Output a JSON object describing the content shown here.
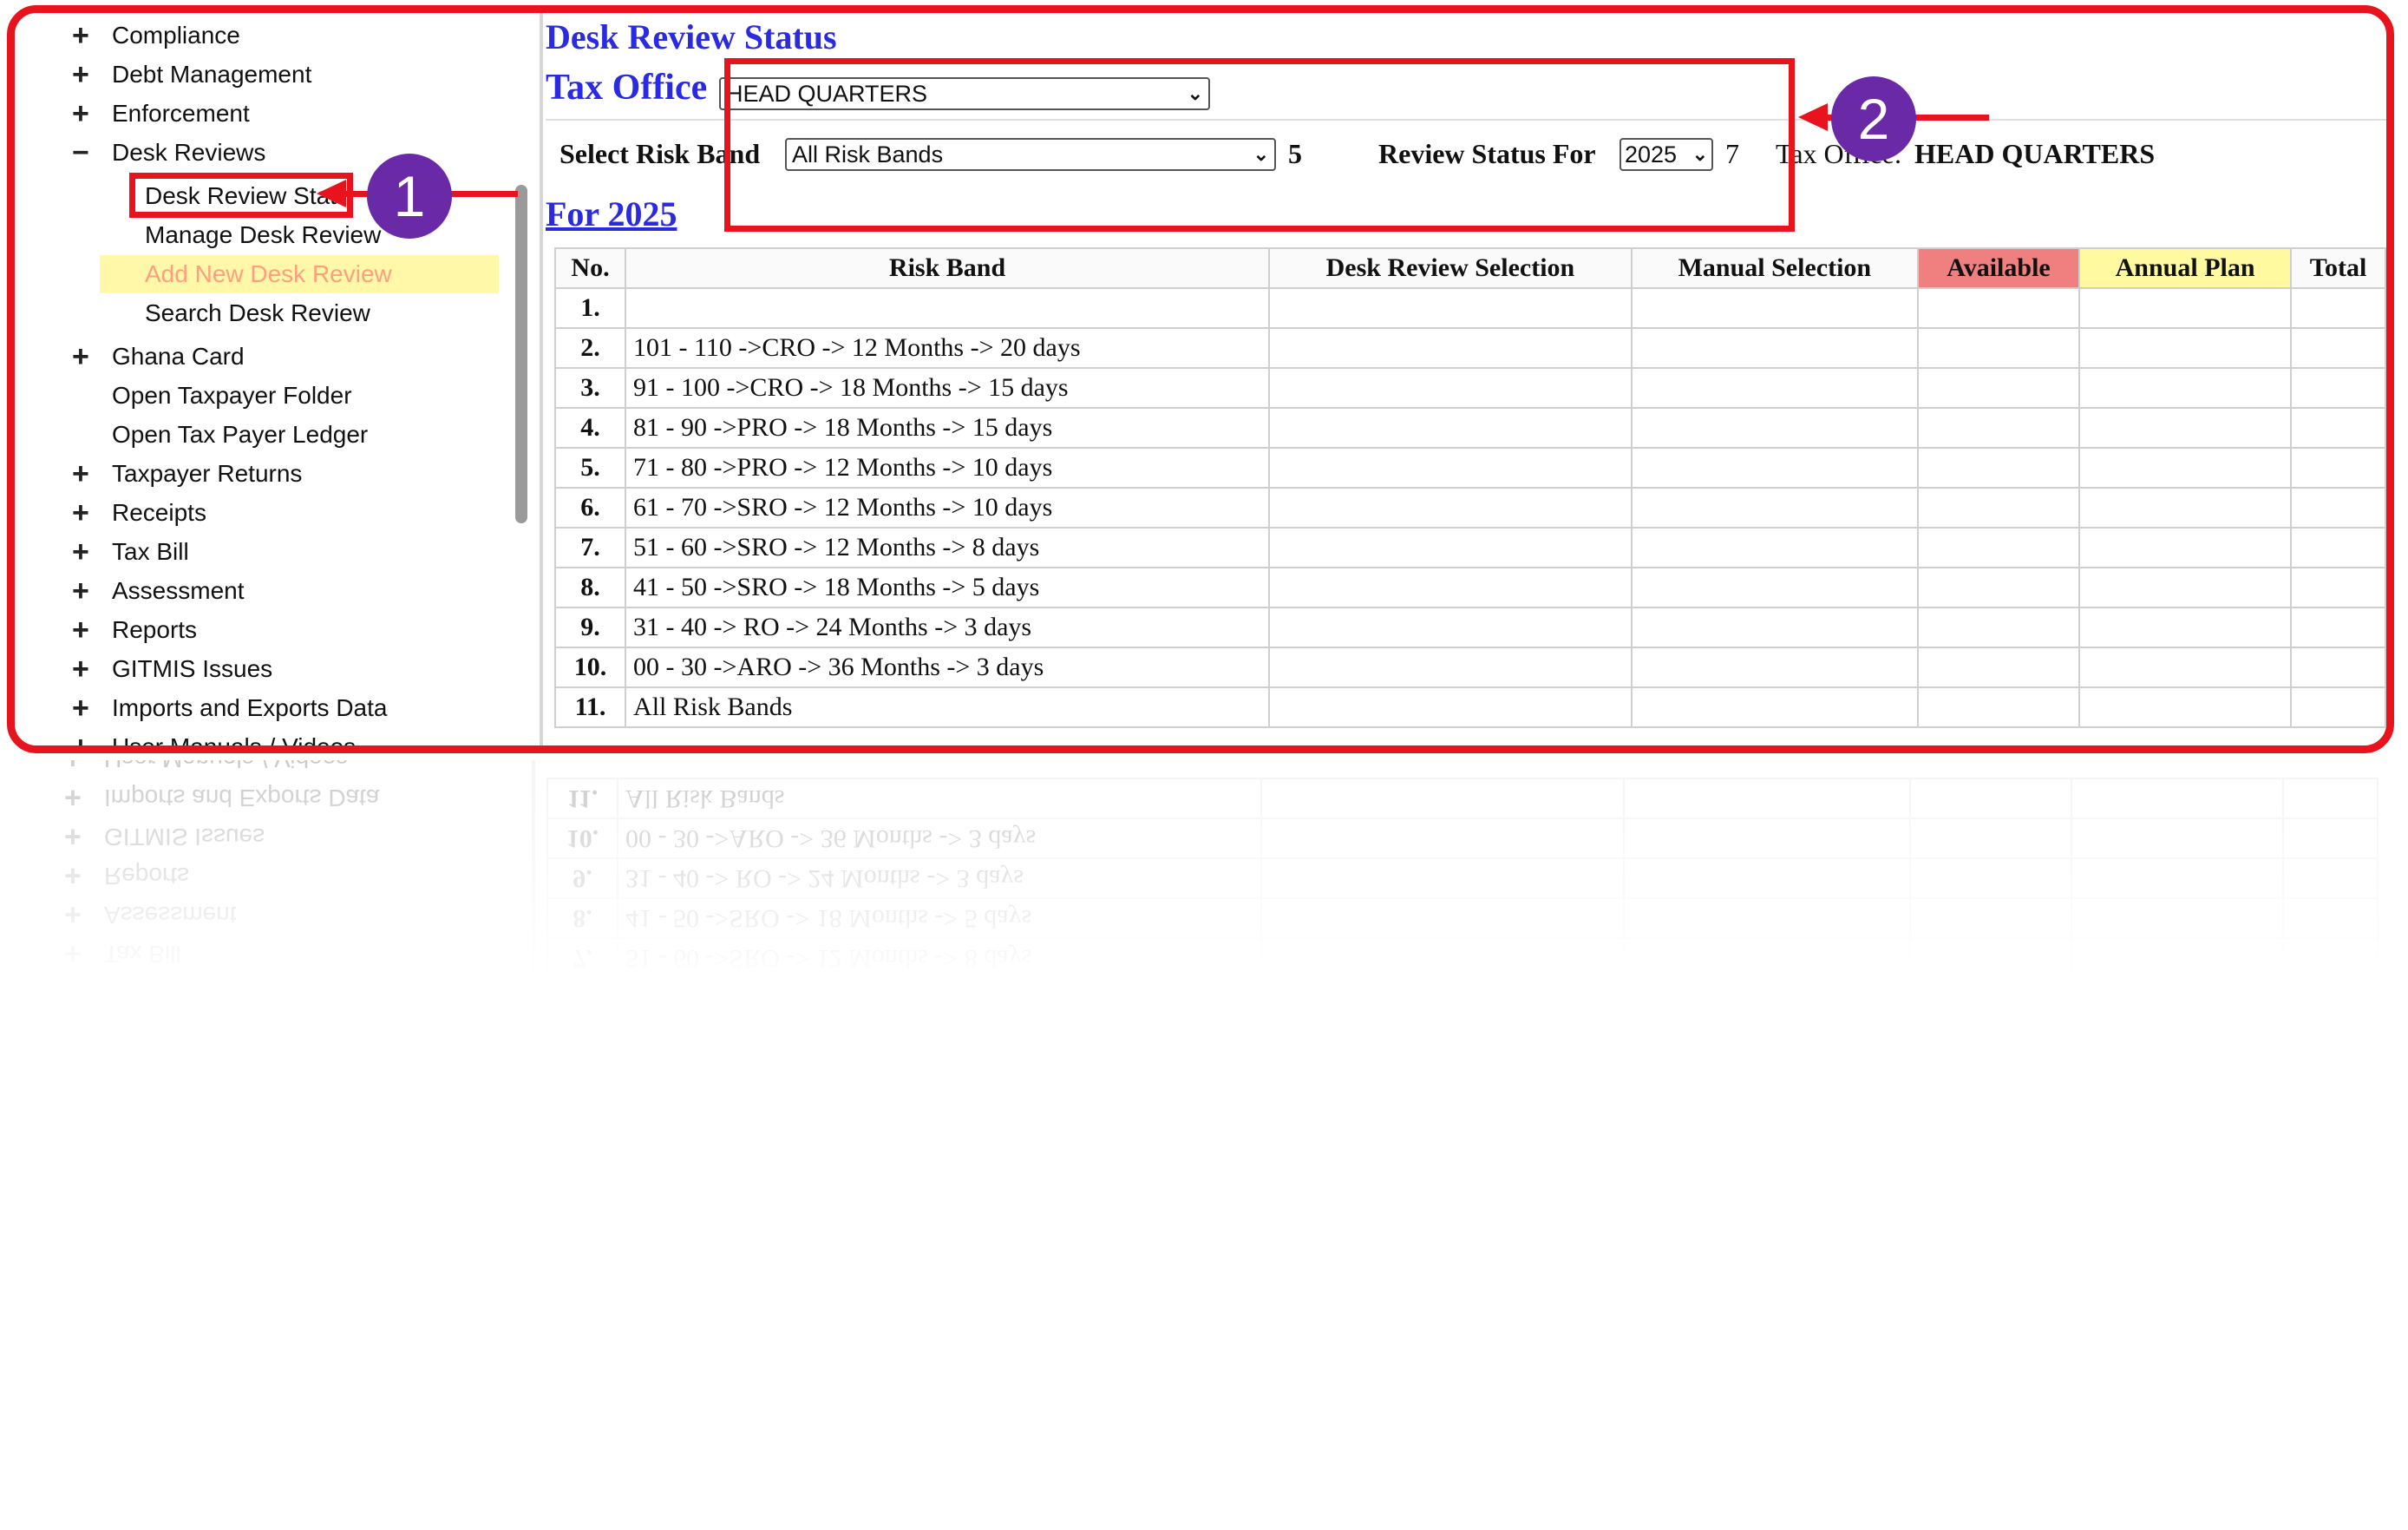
{
  "sidebar": {
    "items": [
      {
        "sign": "+",
        "label": "Compliance"
      },
      {
        "sign": "+",
        "label": "Debt Management"
      },
      {
        "sign": "+",
        "label": "Enforcement"
      },
      {
        "sign": "−",
        "label": "Desk Reviews"
      }
    ],
    "sub_items": [
      {
        "label": "Desk Review Stat"
      },
      {
        "label": "Manage Desk Review"
      },
      {
        "label": "Add New Desk Review"
      },
      {
        "label": "Search Desk Review"
      }
    ],
    "items_after": [
      {
        "sign": "+",
        "label": "Ghana Card"
      },
      {
        "sign": "",
        "label": "Open Taxpayer Folder"
      },
      {
        "sign": "",
        "label": "Open Tax Payer Ledger"
      },
      {
        "sign": "+",
        "label": "Taxpayer Returns"
      },
      {
        "sign": "+",
        "label": "Receipts"
      },
      {
        "sign": "+",
        "label": "Tax Bill"
      },
      {
        "sign": "+",
        "label": "Assessment"
      },
      {
        "sign": "+",
        "label": "Reports"
      },
      {
        "sign": "+",
        "label": "GITMIS Issues"
      },
      {
        "sign": "+",
        "label": "Imports and Exports Data"
      },
      {
        "sign": "+",
        "label": "User Manuals / Videos"
      }
    ]
  },
  "main": {
    "title": "Desk Review Status",
    "tax_office_label": "Tax Office",
    "tax_office_select": "HEAD QUARTERS",
    "risk_band_label": "Select Risk Band",
    "risk_band_select": "All Risk Bands",
    "risk_band_count": "5",
    "review_status_label": "Review Status For",
    "review_year_select": "2025",
    "review_count": "7",
    "tax_office_text_label": "Tax Office:",
    "tax_office_text_value": "HEAD QUARTERS",
    "for_year": "For 2025"
  },
  "table": {
    "headers": [
      "No.",
      "Risk Band",
      "Desk Review Selection",
      "Manual Selection",
      "Available",
      "Annual Plan",
      "Total"
    ],
    "rows": [
      {
        "no": "1.",
        "band": ""
      },
      {
        "no": "2.",
        "band": "101 - 110 ->CRO -> 12 Months -> 20 days"
      },
      {
        "no": "3.",
        "band": "91 - 100 ->CRO -> 18 Months -> 15 days"
      },
      {
        "no": "4.",
        "band": "81 - 90 ->PRO -> 18 Months -> 15 days"
      },
      {
        "no": "5.",
        "band": "71 - 80 ->PRO -> 12 Months -> 10 days"
      },
      {
        "no": "6.",
        "band": "61 - 70 ->SRO -> 12 Months -> 10 days"
      },
      {
        "no": "7.",
        "band": "51 - 60 ->SRO -> 12 Months -> 8 days"
      },
      {
        "no": "8.",
        "band": "41 - 50 ->SRO -> 18 Months -> 5 days"
      },
      {
        "no": "9.",
        "band": "31 - 40 -> RO -> 24 Months -> 3 days"
      },
      {
        "no": "10.",
        "band": "00 - 30 ->ARO -> 36 Months -> 3 days"
      },
      {
        "no": "11.",
        "band": "All Risk Bands"
      }
    ]
  },
  "annotations": {
    "badge1": "1",
    "badge2": "2",
    "accent_color": "#e8141d",
    "badge_color": "#6a2aa8"
  }
}
